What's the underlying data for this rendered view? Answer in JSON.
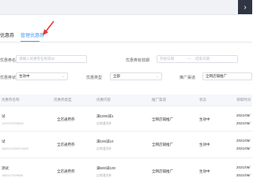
{
  "tabs": [
    {
      "label": "优惠券"
    },
    {
      "label": "管理优惠券"
    }
  ],
  "filters": {
    "name_label": "优惠券名称",
    "name_placeholder": "请输入优惠券名称或ID",
    "validity_label": "优惠券有效期",
    "start_placeholder": "开始日期",
    "date_sep": "—",
    "end_placeholder": "结束日期",
    "status_label": "优惠券状态",
    "status_value": "生效中",
    "type_label": "优惠类型",
    "type_value": "全部",
    "channel_label": "推广渠道",
    "channel_value": "全网店铺推广"
  },
  "table": {
    "headers": [
      "优惠券名称",
      "优惠券类型",
      "优惠内容",
      "推广渠道",
      "状态",
      "领取时间"
    ],
    "rows": [
      {
        "name": "试",
        "id": "1247076753528",
        "type": "全店通用券",
        "content": "满1000减1",
        "content_sub": "店铺通用券",
        "channel": "全网店铺推广",
        "status": "生效中",
        "time1": "2021/06/",
        "time2": "2021/06/"
      },
      {
        "name": "试",
        "id": "1692212920974625",
        "type": "全店通用券",
        "content": "满100减10",
        "content_sub": "店铺通用券",
        "channel": "全网店铺推广",
        "status": "生效中",
        "time1": "2021/06/",
        "time2": "2021/06/"
      },
      {
        "name": "测试",
        "id": "1692117526845",
        "type": "全店通用券",
        "content": "满500减100",
        "content_sub": "店铺通用券",
        "channel": "全网店铺推广",
        "status": "生效中",
        "time1": "2021/06/",
        "time2": "2021/06/"
      }
    ]
  },
  "icons": {
    "scroll": "chevron-right-icon",
    "dropdown": "chevron-down-icon",
    "annotation": "red-arrow-icon"
  },
  "colors": {
    "accent": "#409eff",
    "annotation": "#e53935"
  }
}
